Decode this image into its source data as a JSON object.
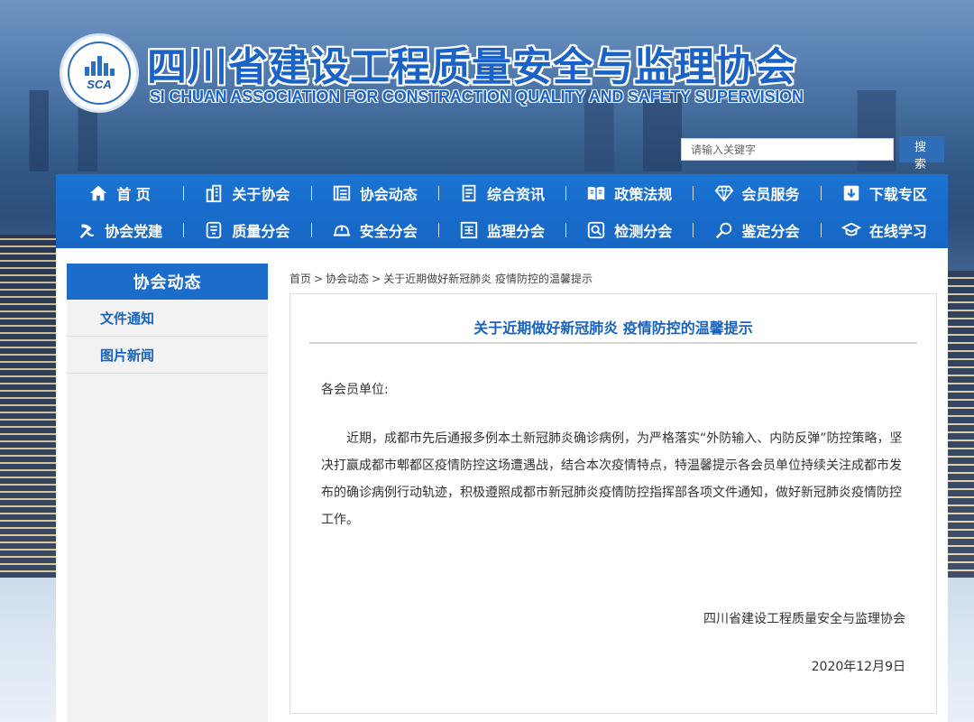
{
  "header": {
    "logo_text": "SCA",
    "title": "四川省建设工程质量安全与监理协会",
    "subtitle": "SI CHUAN ASSOCIATION FOR CONSTRACTION QUALITY AND SAFETY SUPERVISION"
  },
  "search": {
    "placeholder": "请输入关键字",
    "button_label": "搜 索"
  },
  "nav": {
    "row1": [
      {
        "label": "首 页",
        "icon": "home-icon"
      },
      {
        "label": "关于协会",
        "icon": "building-icon"
      },
      {
        "label": "协会动态",
        "icon": "news-icon"
      },
      {
        "label": "综合资讯",
        "icon": "document-icon"
      },
      {
        "label": "政策法规",
        "icon": "book-icon"
      },
      {
        "label": "会员服务",
        "icon": "diamond-icon"
      },
      {
        "label": "下载专区",
        "icon": "download-icon"
      }
    ],
    "row2": [
      {
        "label": "协会党建",
        "icon": "party-emblem-icon"
      },
      {
        "label": "质量分会",
        "icon": "quality-icon"
      },
      {
        "label": "安全分会",
        "icon": "helmet-icon"
      },
      {
        "label": "监理分会",
        "icon": "supervision-icon"
      },
      {
        "label": "检测分会",
        "icon": "inspection-icon"
      },
      {
        "label": "鉴定分会",
        "icon": "magnifier-icon"
      },
      {
        "label": "在线学习",
        "icon": "graduation-cap-icon"
      }
    ]
  },
  "sidebar": {
    "heading": "协会动态",
    "items": [
      {
        "label": "文件通知"
      },
      {
        "label": "图片新闻"
      }
    ]
  },
  "breadcrumb": {
    "items": [
      "首页",
      "协会动态",
      "关于近期做好新冠肺炎 疫情防控的温馨提示"
    ],
    "separator": ">"
  },
  "article": {
    "title": "关于近期做好新冠肺炎 疫情防控的温馨提示",
    "salutation": "各会员单位:",
    "body": "近期，成都市先后通报多例本土新冠肺炎确诊病例，为严格落实“外防输入、内防反弹”防控策略，坚决打赢成都市郫都区疫情防控这场遭遇战，结合本次疫情特点，特温馨提示各会员单位持续关注成都市发布的确诊病例行动轨迹，积极遵照成都市新冠肺炎疫情防控指挥部各项文件通知，做好新冠肺炎疫情防控工作。",
    "signature": "四川省建设工程质量安全与监理协会",
    "date": "2020年12月9日"
  },
  "colors": {
    "brand_blue": "#1a62c6",
    "nav_blue": "#1a73d2",
    "search_button": "#2f6db8"
  }
}
